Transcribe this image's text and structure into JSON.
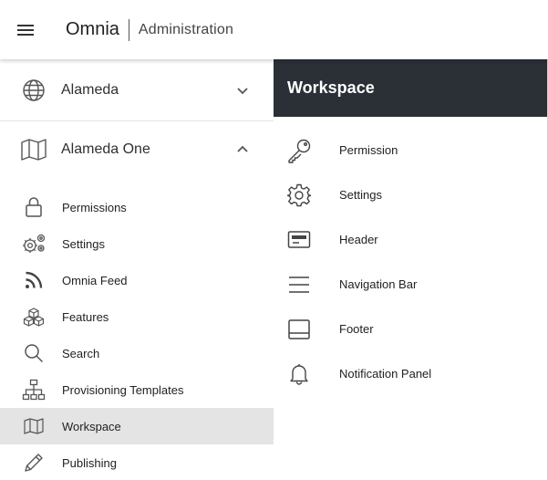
{
  "header": {
    "menu_icon": "hamburger-icon",
    "brand": "Omnia",
    "subtitle": "Administration"
  },
  "sidebar": {
    "tenants": [
      {
        "label": "Alameda",
        "icon": "globe-icon",
        "expanded": false
      },
      {
        "label": "Alameda One",
        "icon": "map-icon",
        "expanded": true
      }
    ],
    "items": [
      {
        "label": "Permissions",
        "icon": "lock-icon"
      },
      {
        "label": "Settings",
        "icon": "gears-icon"
      },
      {
        "label": "Omnia Feed",
        "icon": "rss-icon"
      },
      {
        "label": "Features",
        "icon": "cubes-icon"
      },
      {
        "label": "Search",
        "icon": "search-icon"
      },
      {
        "label": "Provisioning Templates",
        "icon": "sitemap-icon"
      },
      {
        "label": "Workspace",
        "icon": "map-icon",
        "active": true
      },
      {
        "label": "Publishing",
        "icon": "pencil-icon"
      }
    ]
  },
  "panel": {
    "title": "Workspace",
    "items": [
      {
        "label": "Permission",
        "icon": "key-icon"
      },
      {
        "label": "Settings",
        "icon": "gear-icon"
      },
      {
        "label": "Header",
        "icon": "header-icon"
      },
      {
        "label": "Navigation Bar",
        "icon": "navigation-bar-icon"
      },
      {
        "label": "Footer",
        "icon": "footer-icon"
      },
      {
        "label": "Notification Panel",
        "icon": "bell-icon"
      }
    ]
  },
  "colors": {
    "panel_header_bg": "#2b2f36",
    "active_item_bg": "#e4e4e4"
  }
}
